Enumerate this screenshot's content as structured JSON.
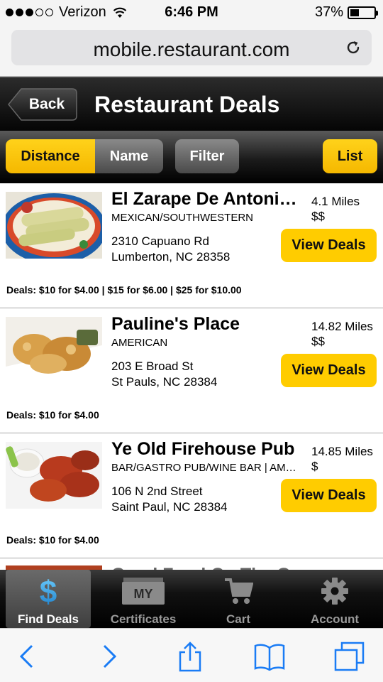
{
  "status_bar": {
    "carrier": "Verizon",
    "time": "6:46 PM",
    "battery_percent": "37%",
    "battery_level": 0.37,
    "signal_bars_filled": 3,
    "signal_bars_total": 5
  },
  "browser": {
    "url": "mobile.restaurant.com",
    "reload_icon": "reload-icon"
  },
  "header": {
    "back_label": "Back",
    "title": "Restaurant Deals"
  },
  "toolbar": {
    "sort_distance": "Distance",
    "sort_name": "Name",
    "filter": "Filter",
    "list": "List"
  },
  "restaurants": [
    {
      "name": "El Zarape De Antonio's",
      "category": "MEXICAN/SOUTHWESTERN",
      "address_line1": "2310 Capuano Rd",
      "address_line2": "Lumberton, NC 28358",
      "distance": "4.1 Miles",
      "price": "$$",
      "button_label": "View Deals",
      "deals": "Deals: $10 for $4.00 | $15 for $6.00 | $25 for $10.00"
    },
    {
      "name": "Pauline's Place",
      "category": "AMERICAN",
      "address_line1": "203 E Broad St",
      "address_line2": "St Pauls, NC 28384",
      "distance": "14.82 Miles",
      "price": "$$",
      "button_label": "View Deals",
      "deals": "Deals: $10 for $4.00"
    },
    {
      "name": "Ye Old Firehouse Pub",
      "category": "BAR/GASTRO PUB/WINE BAR | AMERICAN",
      "address_line1": "106 N 2nd Street",
      "address_line2": "Saint Paul, NC 28384",
      "distance": "14.85 Miles",
      "price": "$",
      "button_label": "View Deals",
      "deals": "Deals: $10 for $4.00"
    }
  ],
  "partial_next": {
    "name": "Good Food On The Go"
  },
  "tab_bar": {
    "tabs": [
      {
        "label": "Find Deals",
        "icon": "dollar-icon",
        "active": true
      },
      {
        "label": "Certificates",
        "icon": "certificate-icon",
        "badge": "MY",
        "active": false
      },
      {
        "label": "Cart",
        "icon": "cart-icon",
        "active": false
      },
      {
        "label": "Account",
        "icon": "gear-icon",
        "active": false
      }
    ]
  },
  "safari_toolbar": {
    "buttons": [
      "back-arrow-icon",
      "forward-arrow-icon",
      "share-icon",
      "bookmarks-icon",
      "tabs-icon"
    ],
    "accent_color": "#1a7cf5"
  },
  "colors": {
    "accent_yellow": "#ffcc00",
    "header_black": "#050505"
  }
}
